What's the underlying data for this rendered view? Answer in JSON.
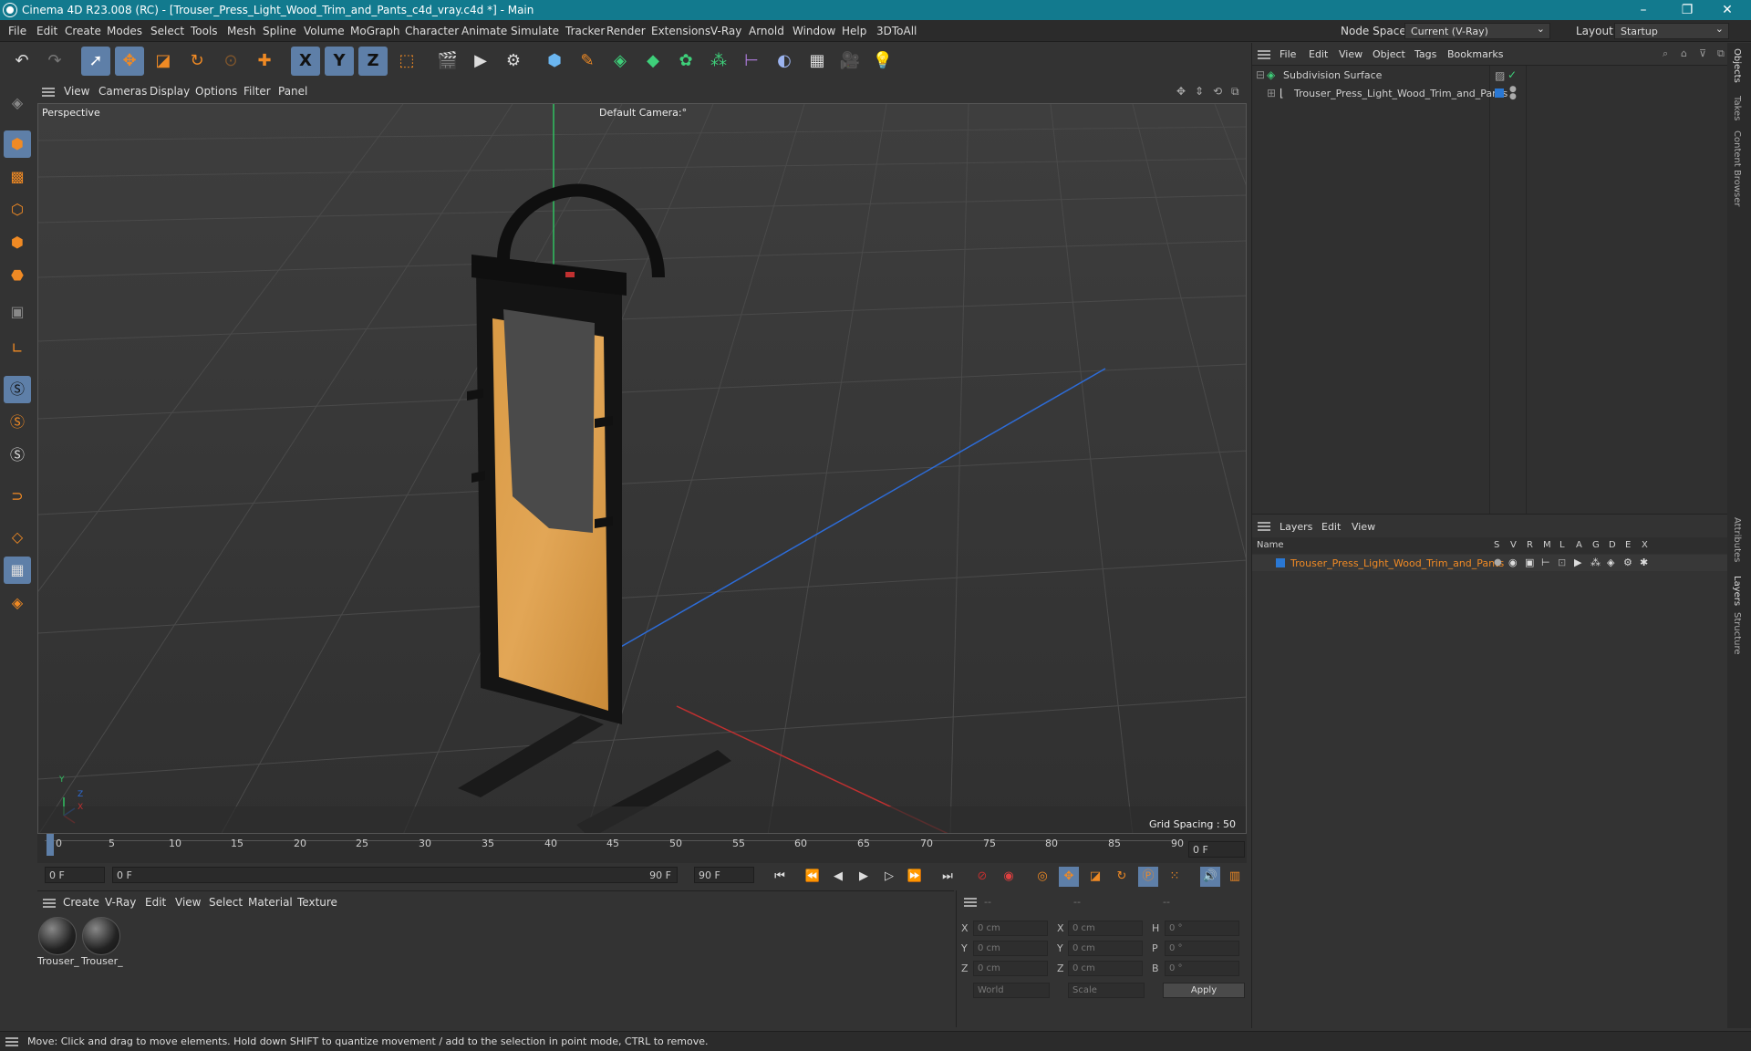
{
  "window": {
    "title": "Cinema 4D R23.008 (RC) - [Trouser_Press_Light_Wood_Trim_and_Pants_c4d_vray.c4d *] - Main",
    "minimize": "–",
    "maximize": "❐",
    "close": "✕"
  },
  "menubar": {
    "items": [
      "File",
      "Edit",
      "Create",
      "Modes",
      "Select",
      "Tools",
      "Mesh",
      "Spline",
      "Volume",
      "MoGraph",
      "Character",
      "Animate",
      "Simulate",
      "Tracker",
      "Render",
      "Extensions",
      "V-Ray",
      "Arnold",
      "Window",
      "Help",
      "3DToAll"
    ],
    "node_space_label": "Node Space:",
    "node_space_value": "Current (V-Ray)",
    "layout_label": "Layout:",
    "layout_value": "Startup"
  },
  "toolbar": {
    "icons": [
      "undo-icon",
      "redo-icon",
      "live-selection-icon",
      "move-icon",
      "scale-icon",
      "rotate-icon",
      "recent-tool-icon",
      "coordinate-system-icon",
      "x-axis-icon",
      "y-axis-icon",
      "z-axis-icon",
      "world-coords-icon",
      "render-region-icon",
      "render-view-icon",
      "render-settings-icon",
      "cube-icon",
      "pen-icon",
      "subdivision-icon",
      "extrude-icon",
      "array-icon",
      "cloner-icon",
      "symmetry-icon",
      "deformer-icon",
      "floor-icon",
      "camera-icon",
      "light-icon"
    ],
    "axis_x": "X",
    "axis_y": "Y",
    "axis_z": "Z"
  },
  "viewport": {
    "menu": [
      "View",
      "Cameras",
      "Display",
      "Options",
      "Filter",
      "Panel"
    ],
    "view_name": "Perspective",
    "camera_name": "Default Camera",
    "camera_suffix": ":°",
    "grid_spacing": "Grid Spacing : 50 cm",
    "axis_x": "X",
    "axis_y": "Y",
    "axis_z": "Z"
  },
  "timeline": {
    "ticks": [
      "0",
      "5",
      "10",
      "15",
      "20",
      "25",
      "30",
      "35",
      "40",
      "45",
      "50",
      "55",
      "60",
      "65",
      "70",
      "75",
      "80",
      "85",
      "90"
    ],
    "current_frame": "0 F"
  },
  "transport": {
    "start_field": "0 F",
    "range_start": "0 F",
    "range_end": "90 F",
    "end_field": "90 F"
  },
  "materials": {
    "menu": [
      "Create",
      "V-Ray",
      "Edit",
      "View",
      "Select",
      "Material",
      "Texture"
    ],
    "items": [
      "Trouser_",
      "Trouser_"
    ]
  },
  "coordinates": {
    "headers": [
      "--",
      "--",
      "--"
    ],
    "rows": [
      {
        "a": "X",
        "v1": "0 cm",
        "b": "X",
        "v2": "0 cm",
        "c": "H",
        "v3": "0 °"
      },
      {
        "a": "Y",
        "v1": "0 cm",
        "b": "Y",
        "v2": "0 cm",
        "c": "P",
        "v3": "0 °"
      },
      {
        "a": "Z",
        "v1": "0 cm",
        "b": "Z",
        "v2": "0 cm",
        "c": "B",
        "v3": "0 °"
      }
    ],
    "mode1": "World",
    "mode2": "Scale",
    "apply": "Apply"
  },
  "objects": {
    "menu": [
      "File",
      "Edit",
      "View",
      "Object",
      "Tags",
      "Bookmarks"
    ],
    "tree": [
      {
        "name": "Subdivision Surface"
      },
      {
        "name": "Trouser_Press_Light_Wood_Trim_and_Pants"
      }
    ]
  },
  "layers": {
    "menu": [
      "Layers",
      "Edit",
      "View"
    ],
    "col_name": "Name",
    "cols": [
      "S",
      "V",
      "R",
      "M",
      "L",
      "A",
      "G",
      "D",
      "E",
      "X"
    ],
    "row_name": "Trouser_Press_Light_Wood_Trim_and_Pants"
  },
  "sidetabs": [
    "Objects",
    "Takes",
    "Content Browser",
    "Attributes",
    "Layers",
    "Structure"
  ],
  "status": "Move: Click and drag to move elements. Hold down SHIFT to quantize movement / add to the selection in point mode, CTRL to remove.",
  "colors": {
    "titlebar": "#127a8e",
    "accent": "#f08a24",
    "highlight": "#5e7fa8",
    "layer_blue": "#2a78d4"
  }
}
